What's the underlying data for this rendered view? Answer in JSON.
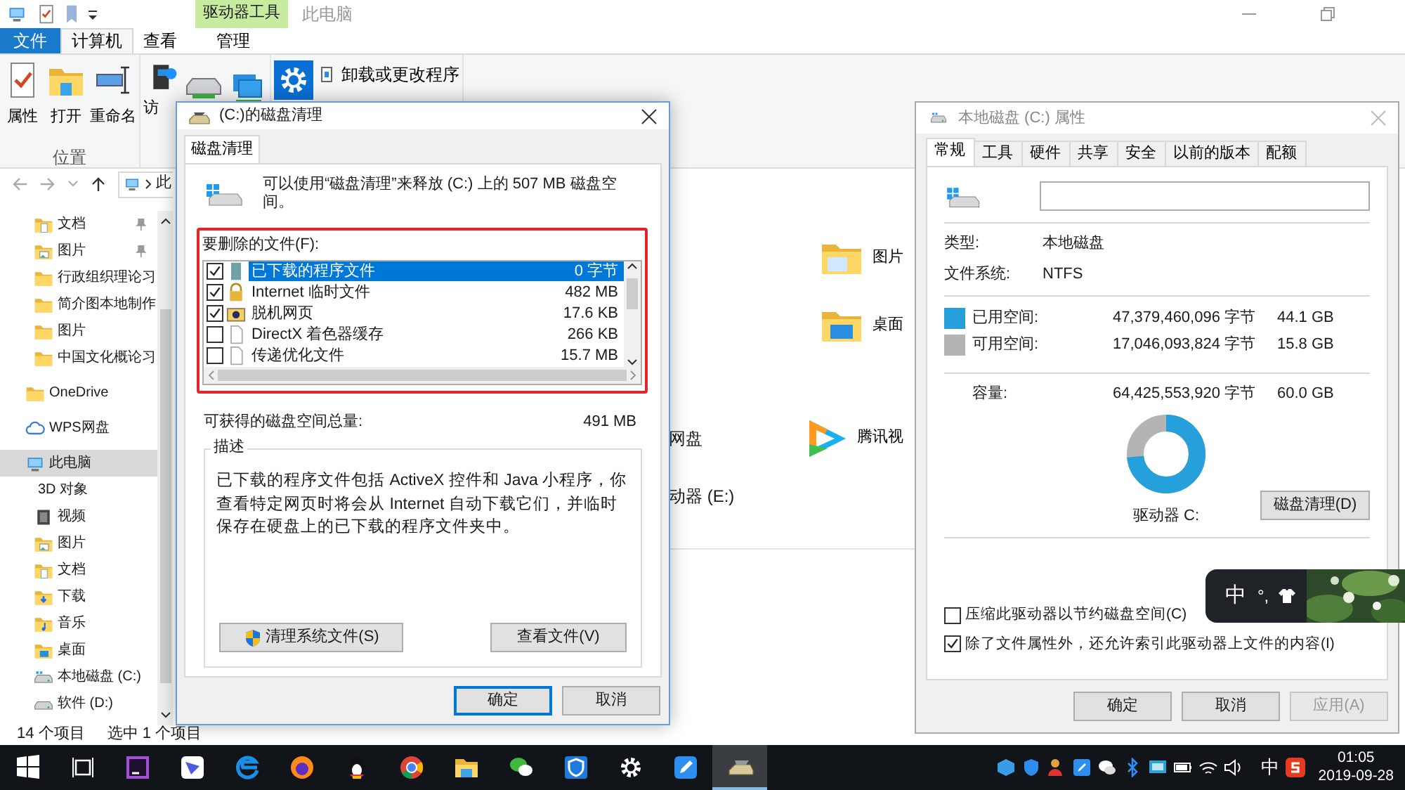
{
  "explorer": {
    "title": "此电脑",
    "context_group": "驱动器工具",
    "tabs": [
      {
        "label": "文件",
        "kind": "file",
        "selected": false
      },
      {
        "label": "计算机",
        "kind": "tab",
        "selected": true
      },
      {
        "label": "查看",
        "kind": "tab",
        "selected": false
      },
      {
        "label": "管理",
        "kind": "context",
        "selected": false
      }
    ],
    "ribbon_buttons": [
      {
        "label": "属性",
        "kind": "properties"
      },
      {
        "label": "打开",
        "kind": "open"
      },
      {
        "label": "重命名",
        "kind": "rename"
      },
      {
        "label": "访",
        "kind": "media"
      },
      {
        "kind": "drive"
      },
      {
        "kind": "network"
      },
      {
        "kind": "settings"
      }
    ],
    "ribbon_links": [
      {
        "label": "卸载或更改程序",
        "kind": "uninstall"
      }
    ],
    "ribbon_group": "位置",
    "address": "此",
    "quick_items": [
      {
        "label": "文档",
        "kind": "doc",
        "pinned": true
      },
      {
        "label": "图片",
        "kind": "picture",
        "pinned": true
      },
      {
        "label": "行政组织理论习",
        "kind": "folder",
        "pinned": false
      },
      {
        "label": "简介图本地制作",
        "kind": "folder",
        "pinned": false
      },
      {
        "label": "图片",
        "kind": "folder",
        "pinned": false
      },
      {
        "label": "中国文化概论习",
        "kind": "folder",
        "pinned": false
      }
    ],
    "nav": [
      {
        "label": "OneDrive",
        "kind": "folder",
        "selected": false
      },
      {
        "label": "WPS网盘",
        "kind": "cloud",
        "selected": false
      },
      {
        "label": "此电脑",
        "kind": "pc",
        "selected": true,
        "children": [
          {
            "label": "3D 对象",
            "kind": "objects",
            "selected": false
          },
          {
            "label": "视频",
            "kind": "video",
            "selected": false
          },
          {
            "label": "图片",
            "kind": "picture",
            "selected": false
          },
          {
            "label": "文档",
            "kind": "doc",
            "selected": false
          },
          {
            "label": "下载",
            "kind": "download",
            "selected": false
          },
          {
            "label": "音乐",
            "kind": "music",
            "selected": false
          },
          {
            "label": "桌面",
            "kind": "desktop",
            "selected": false
          },
          {
            "label": "本地磁盘 (C:)",
            "kind": "drive-c",
            "selected": false
          },
          {
            "label": "软件 (D:)",
            "kind": "drive",
            "selected": false
          }
        ]
      }
    ],
    "content": [
      {
        "label": "图片",
        "kind": "picture-tile"
      },
      {
        "label": "桌面",
        "kind": "desktop-tile"
      },
      {
        "label": "网盘",
        "kind": "text"
      },
      {
        "label": "腾讯视",
        "kind": "video-tile"
      },
      {
        "label": "动器 (E:)",
        "kind": "text"
      }
    ],
    "status": [
      "14 个项目",
      "选中 1 个项目"
    ]
  },
  "cleanup": {
    "title": "(C:)的磁盘清理",
    "tabs": [
      {
        "label": "磁盘清理",
        "selected": true
      }
    ],
    "intro": "可以使用“磁盘清理”来释放 (C:) 上的 507 MB 磁盘空间。",
    "highlighted": true,
    "files_label": "要删除的文件(F):",
    "files": [
      {
        "name": "已下载的程序文件",
        "size": "0 字节",
        "kind": "download",
        "checked": true,
        "selected": true
      },
      {
        "name": "Internet 临时文件",
        "size": "482 MB",
        "kind": "lock",
        "checked": true,
        "selected": false
      },
      {
        "name": "脱机网页",
        "size": "17.6 KB",
        "kind": "offline",
        "checked": true,
        "selected": false
      },
      {
        "name": "DirectX 着色器缓存",
        "size": "266 KB",
        "kind": "file",
        "checked": false,
        "selected": false
      },
      {
        "name": "传递优化文件",
        "size": "15.7 MB",
        "kind": "file",
        "checked": false,
        "selected": false
      }
    ],
    "total_label": "可获得的磁盘空间总量:",
    "total": "491 MB",
    "description_title": "描述",
    "description": "已下载的程序文件包括 ActiveX 控件和 Java 小程序，你查看特定网页时将会从 Internet 自动下载它们，并临时保存在硬盘上的已下载的程序文件夹中。",
    "buttons": [
      {
        "label": "清理系统文件(S)",
        "kind": "shield"
      },
      {
        "label": "查看文件(V)",
        "kind": "plain"
      }
    ],
    "footer_buttons": [
      {
        "label": "确定",
        "default": true
      },
      {
        "label": "取消",
        "default": false
      }
    ]
  },
  "properties": {
    "title": "本地磁盘 (C:) 属性",
    "tabs": [
      {
        "label": "常规",
        "selected": true
      },
      {
        "label": "工具",
        "selected": false
      },
      {
        "label": "硬件",
        "selected": false
      },
      {
        "label": "共享",
        "selected": false
      },
      {
        "label": "安全",
        "selected": false
      },
      {
        "label": "以前的版本",
        "selected": false
      },
      {
        "label": "配额",
        "selected": false
      }
    ],
    "info": [
      {
        "label": "类型:",
        "value": "本地磁盘"
      },
      {
        "label": "文件系统:",
        "value": "NTFS"
      }
    ],
    "space": [
      {
        "label": "已用空间:",
        "bytes": "47,379,460,096 字节",
        "size": "44.1 GB",
        "color": "#26a0da"
      },
      {
        "label": "可用空间:",
        "bytes": "17,046,093,824 字节",
        "size": "15.8 GB",
        "color": "#b4b4b4"
      }
    ],
    "capacity": {
      "label": "容量:",
      "bytes": "64,425,553,920 字节",
      "size": "60.0 GB"
    },
    "usage": {
      "level": 0.735
    },
    "drive_label": "驱动器 C:",
    "cleanup_button": "磁盘清理(D)",
    "options": [
      {
        "label": "压缩此驱动器以节约磁盘空间(C)",
        "checked": false
      },
      {
        "label": "除了文件属性外，还允许索引此驱动器上文件的内容(I)",
        "checked": true
      }
    ],
    "buttons": [
      {
        "label": "确定",
        "disabled": false
      },
      {
        "label": "取消",
        "disabled": false
      },
      {
        "label": "应用(A)",
        "disabled": true
      }
    ]
  },
  "ime": {
    "mode": "中",
    "punctuation": "°,"
  },
  "taskbar": {
    "apps": [
      {
        "kind": "start",
        "selected": false
      },
      {
        "kind": "task-view",
        "selected": false
      },
      {
        "kind": "ide",
        "selected": false
      },
      {
        "kind": "lark",
        "selected": false
      },
      {
        "kind": "edge",
        "selected": false
      },
      {
        "kind": "firefox",
        "selected": false
      },
      {
        "kind": "qq",
        "selected": false
      },
      {
        "kind": "chrome",
        "selected": false
      },
      {
        "kind": "explorer",
        "selected": false
      },
      {
        "kind": "wechat",
        "selected": false
      },
      {
        "kind": "shield",
        "selected": false
      },
      {
        "kind": "settings",
        "selected": false
      },
      {
        "kind": "note",
        "selected": false
      },
      {
        "kind": "cleanup",
        "selected": true
      }
    ],
    "tray": [
      {
        "kind": "cube"
      },
      {
        "kind": "shield"
      },
      {
        "kind": "person"
      },
      {
        "kind": "note"
      },
      {
        "kind": "wechat"
      },
      {
        "kind": "bluetooth"
      },
      {
        "kind": "display"
      },
      {
        "kind": "battery"
      },
      {
        "kind": "wifi"
      },
      {
        "kind": "volume"
      }
    ],
    "ime": "中",
    "time": "01:05",
    "date": "2019-09-28"
  }
}
